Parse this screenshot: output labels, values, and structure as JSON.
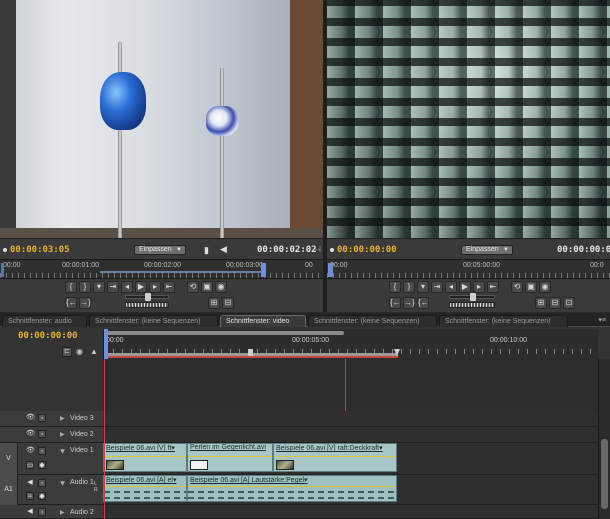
{
  "source_monitor": {
    "timecode_current": "00:00:03:05",
    "fit_label": "Einpassen",
    "timecode_duration": "00:00:02:02",
    "ruler_labels": [
      "00:00",
      "00:00:01:00",
      "00:00:02:00",
      "00:00:03:00",
      "00"
    ]
  },
  "program_monitor": {
    "timecode_current": "00:00:00:00",
    "fit_label": "Einpassen",
    "timecode_duration": "00:00:00:00",
    "ruler_labels": [
      "00:00",
      "00:05:00:00",
      "00:0"
    ]
  },
  "tabs": [
    {
      "label": "Schnittfenster: audio",
      "active": false
    },
    {
      "label": "Schnittfenster: (keine Sequenzen)",
      "active": false
    },
    {
      "label": "Schnittfenster: video",
      "active": true
    },
    {
      "label": "Schnittfenster: (keine Sequenzen)",
      "active": false
    },
    {
      "label": "Schnittfenster: (keine Sequenzen)",
      "active": false
    }
  ],
  "timeline": {
    "timecode": "00:00:00:00",
    "ruler_labels": [
      "00:00",
      "00:00:05:00",
      "00:00:10:00"
    ],
    "tracks": {
      "video3": "Video 3",
      "video2": "Video 2",
      "video1": "Video 1",
      "audio1": "Audio 1",
      "audio2": "Audio 2",
      "v_tag": "V",
      "a_tag": "A1"
    },
    "video_clips": [
      {
        "name": "Beispiele 06.avi [V]",
        "suffix": "ft"
      },
      {
        "name": "Perlen im Gegenlicht.avi",
        "suffix": ""
      },
      {
        "name": "Beispiele 06.avi [V]",
        "suffix": "raft:Deckkraft"
      }
    ],
    "audio_clips": [
      {
        "name": "Beispiele 06.avi [A]",
        "suffix": "el"
      },
      {
        "name": "Beispiele 06.avi [A]",
        "suffix": "Lautstärke:Pegel"
      }
    ]
  }
}
